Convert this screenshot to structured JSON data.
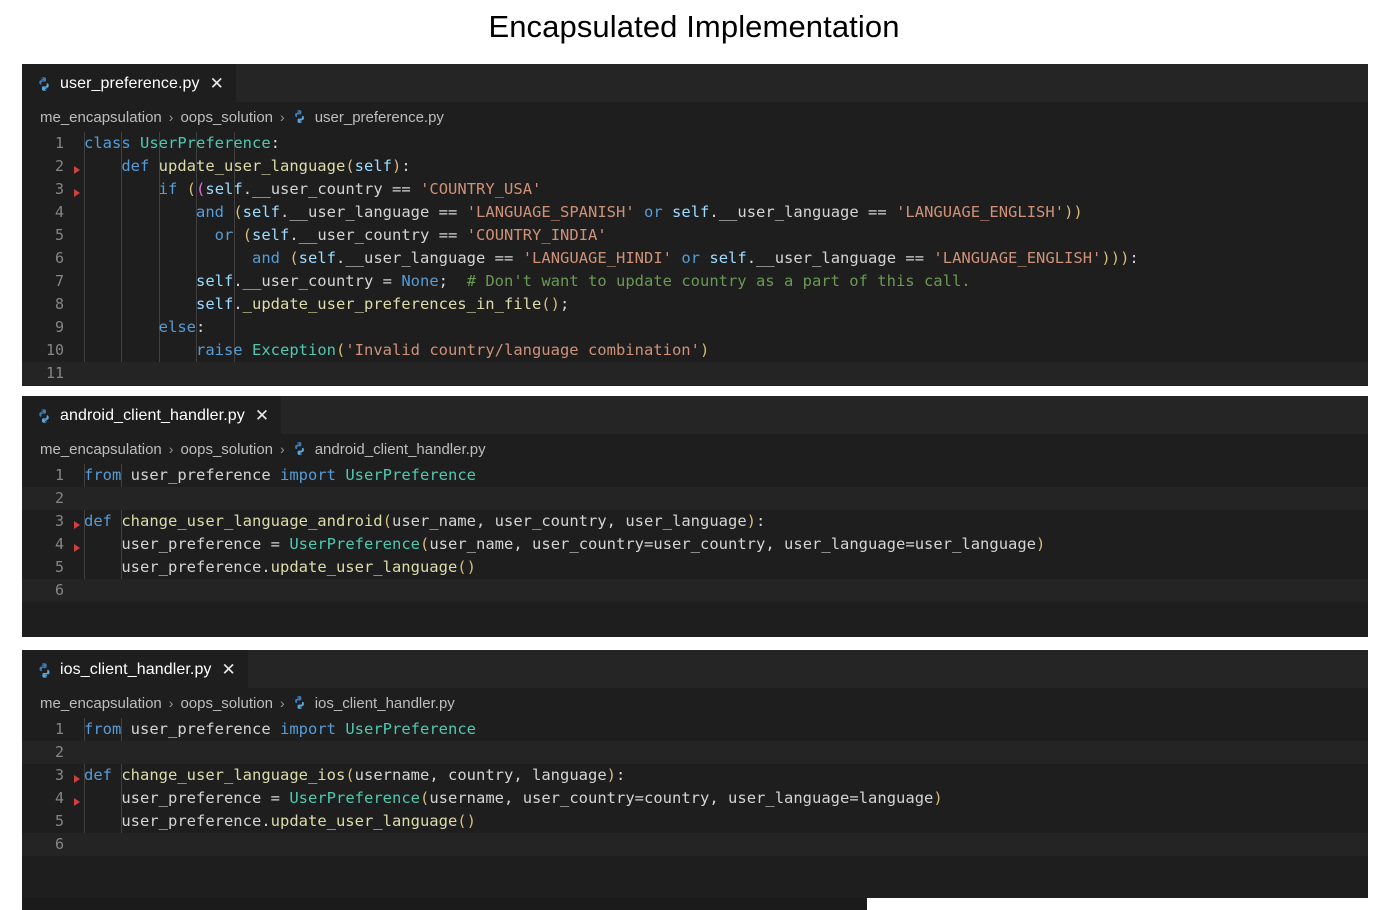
{
  "slide": {
    "title": "Encapsulated Implementation"
  },
  "icons": {
    "python": "python-file-icon",
    "close": "close-icon",
    "chevron": "chevron-right-icon"
  },
  "panels": [
    {
      "id": "user-preference",
      "tab": {
        "label": "user_preference.py",
        "close": "✕"
      },
      "breadcrumb": [
        "me_encapsulation",
        "oops_solution",
        "user_preference.py"
      ],
      "breadcrumb_sep": "›",
      "lines": [
        {
          "num": "1",
          "fold": false,
          "plain": "class UserPreference:"
        },
        {
          "num": "2",
          "fold": true,
          "plain": "    def update_user_language(self):"
        },
        {
          "num": "3",
          "fold": true,
          "plain": "        if ((self.__user_country == 'COUNTRY_USA'"
        },
        {
          "num": "4",
          "fold": false,
          "plain": "            and (self.__user_language == 'LANGUAGE_SPANISH' or self.__user_language == 'LANGUAGE_ENGLISH'))"
        },
        {
          "num": "5",
          "fold": false,
          "plain": "              or (self.__user_country == 'COUNTRY_INDIA'"
        },
        {
          "num": "6",
          "fold": false,
          "plain": "                  and (self.__user_language == 'LANGUAGE_HINDI' or self.__user_language == 'LANGUAGE_ENGLISH'))):"
        },
        {
          "num": "7",
          "fold": false,
          "plain": "            self.__user_country = None;  # Don't want to update country as a part of this call."
        },
        {
          "num": "8",
          "fold": false,
          "plain": "            self._update_user_preferences_in_file();"
        },
        {
          "num": "9",
          "fold": false,
          "plain": "        else:"
        },
        {
          "num": "10",
          "fold": false,
          "plain": "            raise Exception('Invalid country/language combination')"
        },
        {
          "num": "11",
          "fold": false,
          "plain": ""
        }
      ]
    },
    {
      "id": "android-client-handler",
      "tab": {
        "label": "android_client_handler.py",
        "close": "✕"
      },
      "breadcrumb": [
        "me_encapsulation",
        "oops_solution",
        "android_client_handler.py"
      ],
      "breadcrumb_sep": "›",
      "lines": [
        {
          "num": "1",
          "fold": false,
          "plain": "from user_preference import UserPreference"
        },
        {
          "num": "2",
          "fold": false,
          "plain": ""
        },
        {
          "num": "3",
          "fold": true,
          "plain": "def change_user_language_android(user_name, user_country, user_language):"
        },
        {
          "num": "4",
          "fold": true,
          "plain": "    user_preference = UserPreference(user_name, user_country=user_country, user_language=user_language)"
        },
        {
          "num": "5",
          "fold": false,
          "plain": "    user_preference.update_user_language()"
        },
        {
          "num": "6",
          "fold": false,
          "plain": ""
        }
      ]
    },
    {
      "id": "ios-client-handler",
      "tab": {
        "label": "ios_client_handler.py",
        "close": "✕"
      },
      "breadcrumb": [
        "me_encapsulation",
        "oops_solution",
        "ios_client_handler.py"
      ],
      "breadcrumb_sep": "›",
      "lines": [
        {
          "num": "1",
          "fold": false,
          "plain": "from user_preference import UserPreference"
        },
        {
          "num": "2",
          "fold": false,
          "plain": ""
        },
        {
          "num": "3",
          "fold": true,
          "plain": "def change_user_language_ios(username, country, language):"
        },
        {
          "num": "4",
          "fold": true,
          "plain": "    user_preference = UserPreference(username, user_country=country, user_language=language)"
        },
        {
          "num": "5",
          "fold": false,
          "plain": "    user_preference.update_user_language()"
        },
        {
          "num": "6",
          "fold": false,
          "plain": ""
        }
      ]
    }
  ],
  "colors": {
    "editor_background": "#1e1e1e",
    "tabbar_background": "#252526",
    "keyword": "#569cd6",
    "string": "#ce9178",
    "comment": "#6a9955",
    "variable": "#9cdcfe",
    "function": "#dcdcaa",
    "class_name": "#4ec9b0",
    "line_number": "#868686",
    "breadcrumb_text": "#bdbdbd",
    "fold_marker": "#d04040",
    "title_text": "#000000",
    "page_background": "#ffffff"
  }
}
